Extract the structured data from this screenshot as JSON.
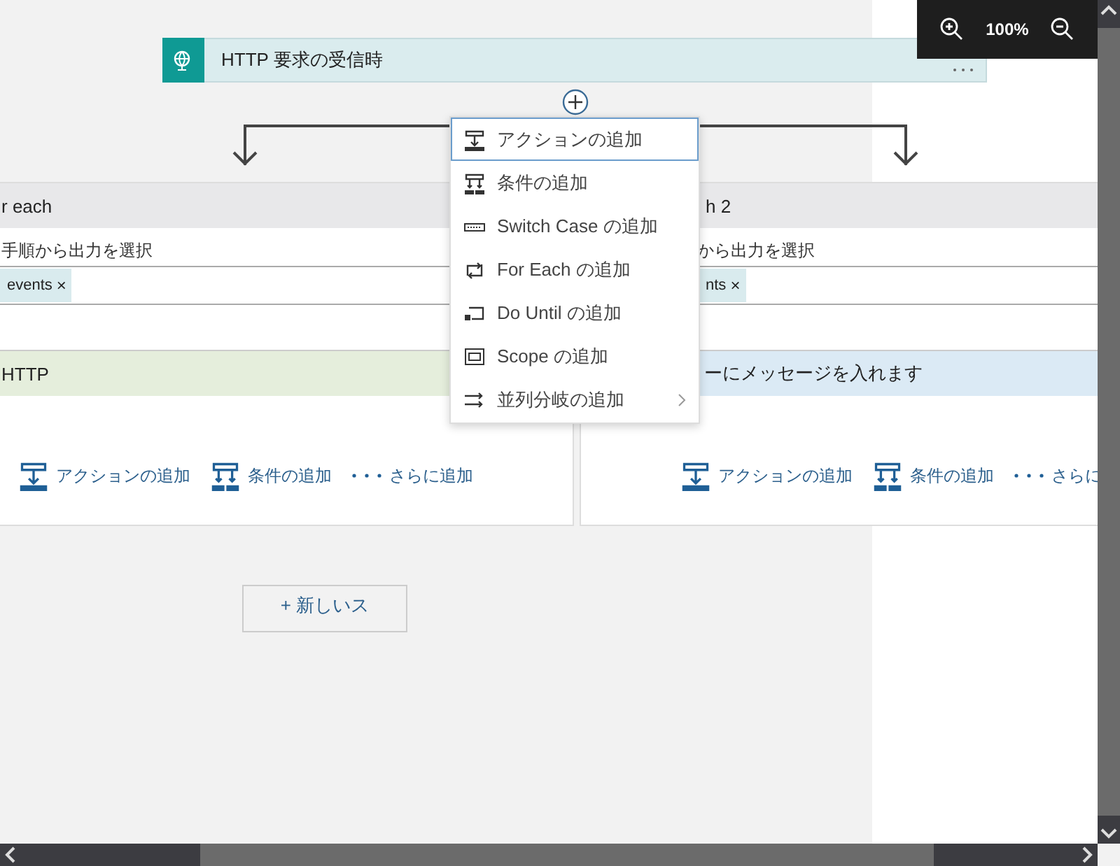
{
  "zoom": {
    "level": "100%"
  },
  "trigger": {
    "title": "HTTP 要求の受信時"
  },
  "branches": [
    {
      "title": "r each",
      "field_label": "手順から出力を選択",
      "tokens": [
        {
          "label": "events",
          "remove": "×"
        }
      ],
      "action": {
        "kind": "http",
        "title": "HTTP"
      },
      "add_buttons": [
        {
          "kind": "action",
          "label": "アクションの追加"
        },
        {
          "kind": "condition",
          "label": "条件の追加"
        },
        {
          "kind": "more",
          "label": "さらに追加"
        }
      ]
    },
    {
      "title": "h 2",
      "field_label": "から出力を選択",
      "tokens": [
        {
          "label": "nts",
          "remove": "×"
        }
      ],
      "action": {
        "kind": "queue",
        "title": "ーにメッセージを入れます"
      },
      "add_buttons": [
        {
          "kind": "action",
          "label": "アクションの追加"
        },
        {
          "kind": "condition",
          "label": "条件の追加"
        },
        {
          "kind": "more",
          "label": "さらに"
        }
      ]
    }
  ],
  "menu": [
    {
      "kind": "action",
      "label": "アクションの追加",
      "selected": true,
      "submenu": false
    },
    {
      "kind": "condition",
      "label": "条件の追加",
      "selected": false,
      "submenu": false
    },
    {
      "kind": "switch",
      "label": "Switch Case の追加",
      "selected": false,
      "submenu": false
    },
    {
      "kind": "foreach",
      "label": "For Each の追加",
      "selected": false,
      "submenu": false
    },
    {
      "kind": "dountil",
      "label": "Do Until の追加",
      "selected": false,
      "submenu": false
    },
    {
      "kind": "scope",
      "label": "Scope の追加",
      "selected": false,
      "submenu": false
    },
    {
      "kind": "parallel",
      "label": "並列分岐の追加",
      "selected": false,
      "submenu": true
    }
  ],
  "new_step_button": "+ 新しいス"
}
